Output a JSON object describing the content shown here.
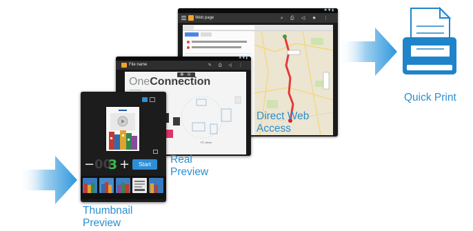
{
  "captions": {
    "thumbnail_preview": [
      "Thumbnail",
      "Preview"
    ],
    "real_preview": [
      "Real",
      "Preview"
    ],
    "direct_web_access": [
      "Direct Web",
      "Access"
    ],
    "quick_print": "Quick Print"
  },
  "colors": {
    "accent_blue": "#2a8fd0",
    "arrow_blue": "#3aa5e6",
    "printer_blue": "#1f84c9",
    "count_green": "#3cb94a"
  },
  "icons": {
    "arrow": "arrow-right-icon",
    "printer": "printer-icon"
  },
  "web_screen": {
    "title": "Web page",
    "tools": "⌕ ⎙ ◁ ★ ⋮"
  },
  "doc_screen": {
    "title": "File name",
    "brand_light": "One",
    "brand_bold": "Connection"
  },
  "print_screen": {
    "minus": "−",
    "count_dim": "00",
    "count": "3",
    "plus": "+",
    "start_label": "Start"
  }
}
